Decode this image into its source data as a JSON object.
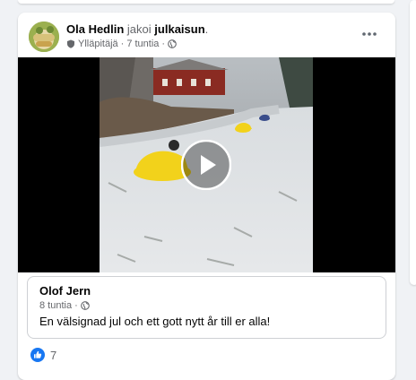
{
  "post": {
    "author": "Ola Hedlin",
    "action_verb": "jakoi",
    "action_object": "julkaisun",
    "action_end": ".",
    "role": "Ylläpitäjä",
    "separator": "·",
    "time": "7 tuntia",
    "separator2": "·"
  },
  "shared_post": {
    "author": "Olof Jern",
    "time": "8 tuntia",
    "separator": "·",
    "text": "En välsignad jul och ett gott nytt år till er alla!"
  },
  "reactions": {
    "count": "7",
    "icon": "like-icon"
  },
  "colors": {
    "link_blue": "#1877f2",
    "secondary_text": "#65676b",
    "primary_text": "#050505",
    "kart_yellow": "#f2d21b"
  }
}
